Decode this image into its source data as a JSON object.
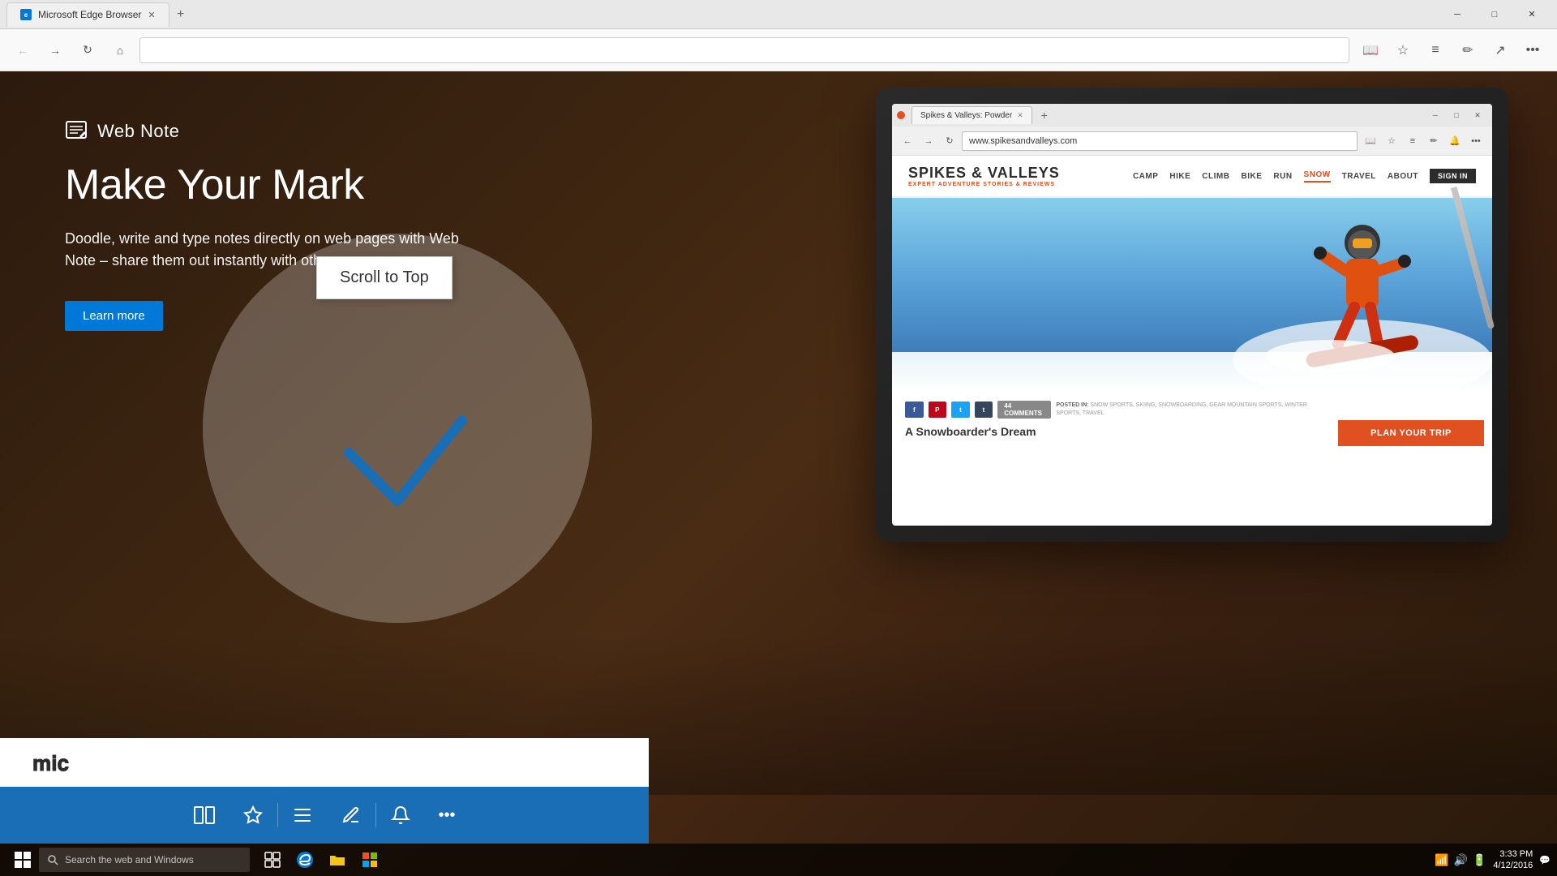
{
  "browser": {
    "tab_title": "Microsoft Edge Browser",
    "tab_favicon": "E",
    "url": "",
    "window_controls": {
      "minimize": "─",
      "maximize": "□",
      "close": "✕"
    }
  },
  "hero": {
    "section_icon": "✏",
    "section_label": "Web Note",
    "headline": "Make Your Mark",
    "description": "Doodle, write and type notes directly on web pages with Web Note – share them out instantly with others.",
    "cta_label": "Learn more"
  },
  "scroll_to_top": {
    "label": "Scroll to Top"
  },
  "inner_browser": {
    "tab_title": "Spikes & Valleys: Powder",
    "url": "www.spikesandvalleys.com",
    "site": {
      "logo": "SPIKES & VALLEYS",
      "tagline": "EXPERT ADVENTURE STORIES & REVIEWS",
      "nav_links": [
        "CAMP",
        "HIKE",
        "CLIMB",
        "BIKE",
        "RUN",
        "SNOW",
        "TRAVEL",
        "ABOUT"
      ],
      "sign_in": "SIGN IN",
      "active_nav": "SNOW",
      "comments_count": "44 COMMENTS",
      "posted_label": "POSTED IN:",
      "posted_categories": "SNOW SPORTS, SKIING, SNOWBOARDING, GEAR MOUNTAIN SPORTS, WINTER SPORTS, TRAVEL",
      "article_title": "A Snowboarder's Dream",
      "plan_trip": "PLAN YOUR TRIP"
    }
  },
  "taskbar": {
    "search_placeholder": "Search the web and Windows",
    "time": "3:33 PM",
    "date": "4/12/2016",
    "system_icons": [
      "▲",
      "🔊",
      "🔋",
      "📶"
    ]
  },
  "bottom_toolbar": {
    "tools": [
      "⊞",
      "☆",
      "≡",
      "✏",
      "🔔",
      "•••"
    ]
  }
}
